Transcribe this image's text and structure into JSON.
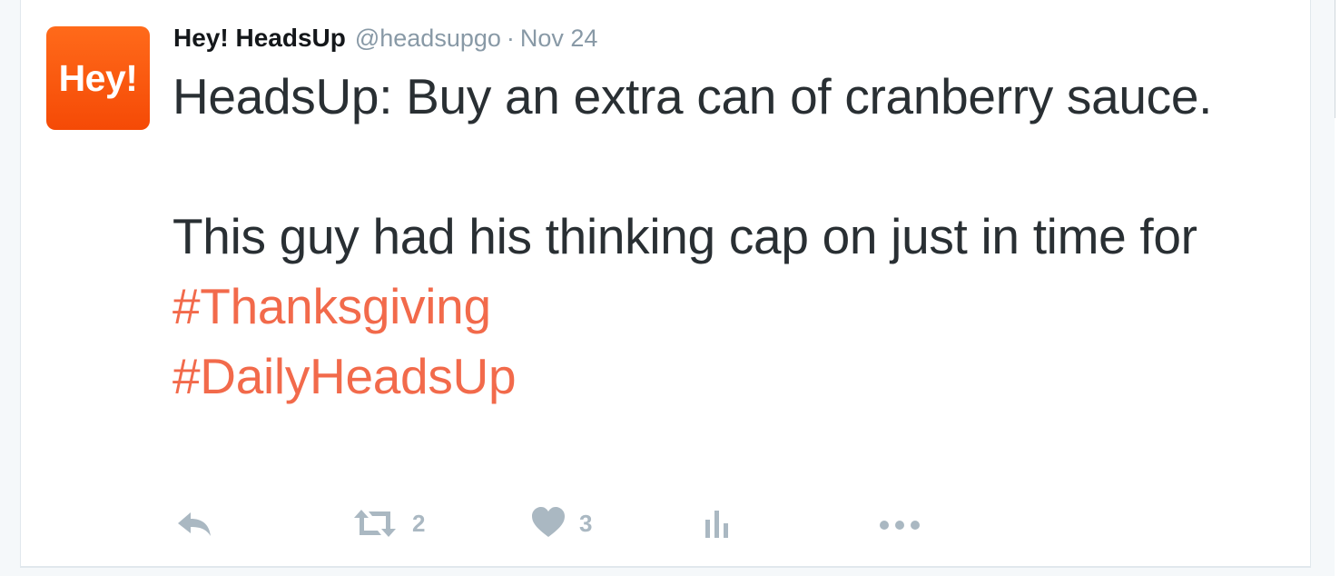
{
  "tweet": {
    "avatar_text": "Hey!",
    "fullname": "Hey! HeadsUp",
    "screenname": "@headsupgo",
    "separator": "·",
    "time": "Nov 24",
    "text_line1": "HeadsUp: Buy an extra can of cranberry sauce.\n\nThis guy had his thinking cap on just in time for ",
    "hashtag1": "#Thanksgiving",
    "hashtag2": "#DailyHeadsUp"
  },
  "actions": {
    "reply_icon": "reply-icon",
    "retweet_icon": "retweet-icon",
    "retweet_count": "2",
    "like_icon": "heart-icon",
    "like_count": "3",
    "analytics_icon": "analytics-icon",
    "more_icon": "more-icon"
  },
  "colors": {
    "avatar": "#f54a06",
    "hashtag": "#f26a4b",
    "muted": "#aab8c2",
    "text": "#292f33"
  }
}
